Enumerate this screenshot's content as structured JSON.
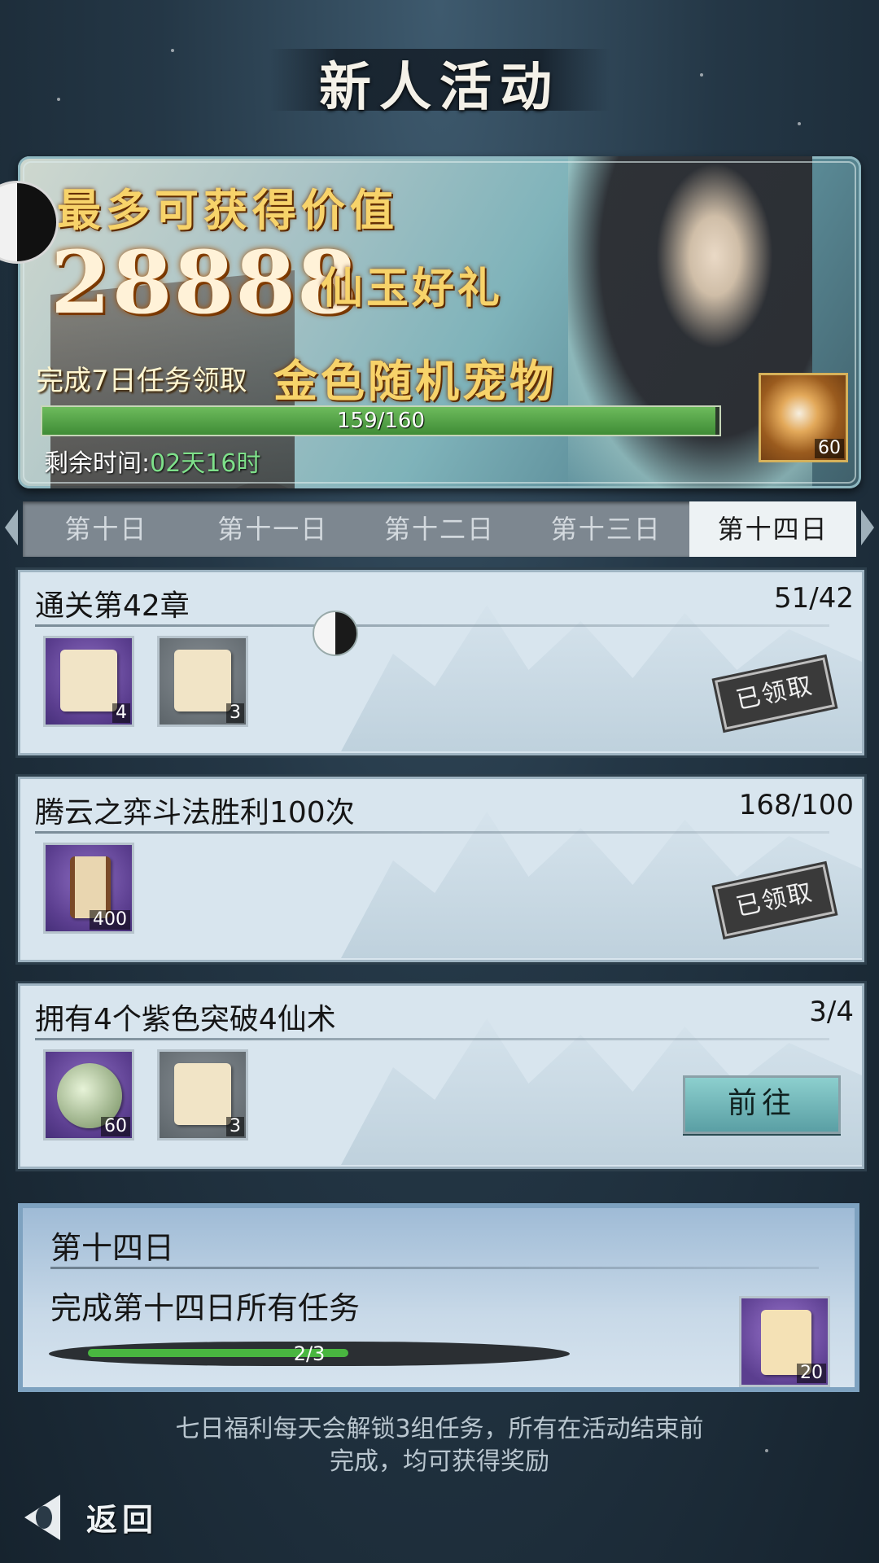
{
  "header": {
    "title": "新人活动"
  },
  "banner": {
    "line1": "最多可获得价值",
    "amount": "28888",
    "gift": "仙玉好礼",
    "task_text": "完成7日任务领取",
    "pet_text": "金色随机宠物",
    "progress": {
      "label": "159/160",
      "current": 159,
      "total": 160
    },
    "time_label": "剩余时间:",
    "time_value": "02天16时",
    "reward": {
      "icon": "golden-pet-egg-icon",
      "qty": "60"
    }
  },
  "tabs": [
    {
      "label": "第十日",
      "active": false
    },
    {
      "label": "第十一日",
      "active": false
    },
    {
      "label": "第十二日",
      "active": false
    },
    {
      "label": "第十三日",
      "active": false
    },
    {
      "label": "第十四日",
      "active": true
    }
  ],
  "tasks": [
    {
      "title": "通关第42章",
      "count": "51/42",
      "rewards": [
        {
          "icon": "spell-scroll-icon",
          "qty": "4",
          "rarity": "purple"
        },
        {
          "icon": "paper-scroll-icon",
          "qty": "3",
          "rarity": "gray"
        }
      ],
      "status": "已领取"
    },
    {
      "title": "腾云之弈斗法胜利100次",
      "count": "168/100",
      "rewards": [
        {
          "icon": "rolled-scroll-icon",
          "qty": "400",
          "rarity": "purple"
        }
      ],
      "status": "已领取"
    },
    {
      "title": "拥有4个紫色突破4仙术",
      "count": "3/4",
      "rewards": [
        {
          "icon": "landscape-fragment-icon",
          "qty": "60",
          "rarity": "purple"
        },
        {
          "icon": "paper-scroll-icon",
          "qty": "3",
          "rarity": "gray"
        }
      ],
      "action": "前往"
    }
  ],
  "day_summary": {
    "title": "第十四日",
    "desc": "完成第十四日所有任务",
    "progress": {
      "label": "2/3",
      "current": 2,
      "total": 3
    },
    "reward": {
      "icon": "talisman-scroll-icon",
      "qty": "20"
    }
  },
  "footer": {
    "note_line1": "七日福利每天会解锁3组任务，所有在活动结束前",
    "note_line2": "完成，均可获得奖励"
  },
  "back": {
    "label": "返回"
  },
  "colors": {
    "progress_green": "#4fa744",
    "time_green": "#7ee08a",
    "active_tab": "#edf2f4"
  }
}
